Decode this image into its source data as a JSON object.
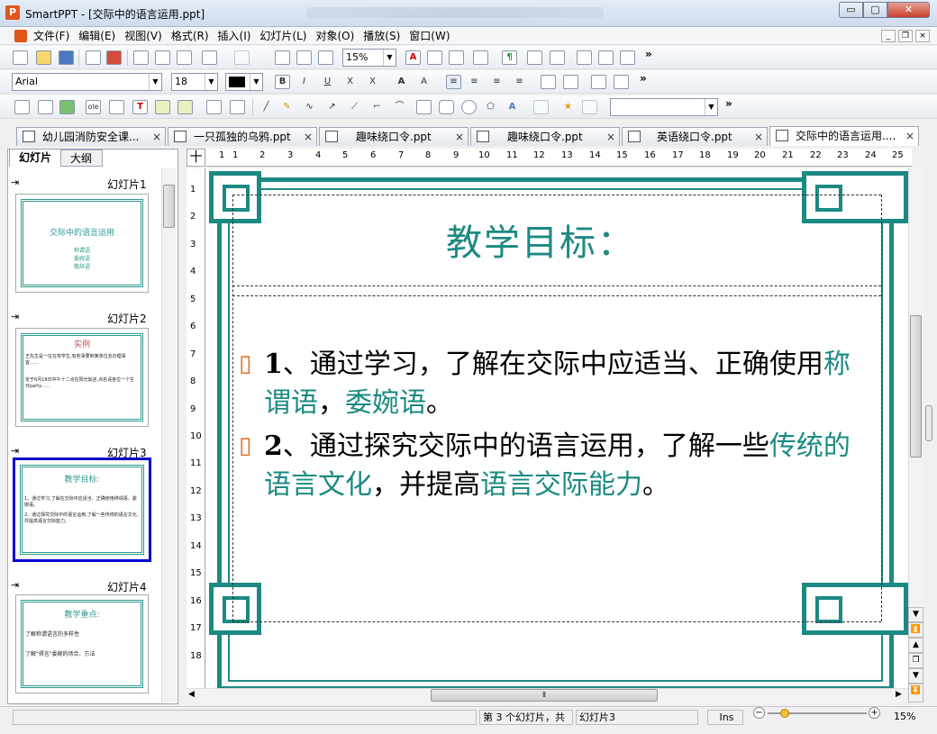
{
  "window": {
    "title": "SmartPPT - [交际中的语言运用.ppt]",
    "app_icon": "P",
    "min_label": "▭",
    "max_label": "▢",
    "close_label": "✕"
  },
  "menu": {
    "items": [
      "文件(F)",
      "编辑(E)",
      "视图(V)",
      "格式(R)",
      "插入(I)",
      "幻灯片(L)",
      "对象(O)",
      "播放(S)",
      "窗口(W)"
    ],
    "mdi_min": "_",
    "mdi_restore": "❐",
    "mdi_close": "×"
  },
  "toolbar1": {
    "zoom_value": "15%",
    "more": "»"
  },
  "toolbar2": {
    "font_name": "Arial",
    "font_size": "18",
    "bold": "B",
    "italic": "I",
    "underline": "U",
    "strike": "X",
    "clear": "X",
    "grow": "A",
    "shrink": "A",
    "more": "»"
  },
  "toolbar3": {
    "more": "»",
    "style_value": ""
  },
  "tabs": [
    {
      "label": "幼儿园消防安全课...",
      "close": "×"
    },
    {
      "label": "一只孤独的乌鸦.ppt",
      "close": "×"
    },
    {
      "label": "趣味绕口令.ppt",
      "close": "×"
    },
    {
      "label": "趣味绕口令.ppt",
      "close": "×"
    },
    {
      "label": "英语绕口令.ppt",
      "close": "×"
    },
    {
      "label": "交际中的语言运用....",
      "close": "×"
    }
  ],
  "panel": {
    "tab_slides": "幻灯片",
    "tab_outline": "大纲",
    "slides": [
      {
        "name": "幻灯片1",
        "title": "交际中的语言运用",
        "lines": [
          "称谓语",
          "委婉语",
          "敬辞语"
        ]
      },
      {
        "name": "幻灯片2",
        "title": "实例",
        "lines": [
          "王先生是一位在校学生,有些事要到某单位去办理事宜……",
          "定于6月18日中午十二点在阳光饭店,点名请各位一个生日party……"
        ]
      },
      {
        "name": "幻灯片3",
        "title": "教学目标:",
        "lines": [
          "1、通过学习,了解在交际中应适当、正确使用称谓语、委婉语。",
          "2、通过探究交际中的语言运用,了解一些传统的语言文化,并提高语言交际能力。"
        ]
      },
      {
        "name": "幻灯片4",
        "title": "教学重点:",
        "lines": [
          "了解称谓语言的多样性",
          "了解\"得言\"委婉的场合、方法"
        ]
      }
    ]
  },
  "ruler": {
    "corner": "十",
    "h": [
      "1",
      "1",
      "2",
      "3",
      "4",
      "5",
      "6",
      "7",
      "8",
      "9",
      "10",
      "11",
      "12",
      "13",
      "14",
      "15",
      "16",
      "17",
      "18",
      "19",
      "20",
      "21",
      "22",
      "23",
      "24",
      "25"
    ],
    "v": [
      "1",
      "2",
      "3",
      "4",
      "5",
      "6",
      "7",
      "8",
      "9",
      "10",
      "11",
      "12",
      "13",
      "14",
      "15",
      "16",
      "17",
      "18"
    ]
  },
  "slide": {
    "title": "教学目标：",
    "bullet_marker": "▯",
    "b1": {
      "n": "1",
      "a": "、通过学习，了解在交际中应适当、正确使用",
      "h1": "称谓语",
      "b": "，",
      "h2": "委婉语",
      "c": "。"
    },
    "b2": {
      "n": "2",
      "a": "、通过探究交际中的语言运用，了解一些",
      "h1": "传统的语言文化",
      "b": "，并提高",
      "h2": "语言交际能力",
      "c": "。"
    }
  },
  "status": {
    "slide_pos": "第 3 个幻灯片，共",
    "slide_name": "幻灯片3",
    "ins": "Ins",
    "zoom": "15%",
    "zoom_fraction": 0.15
  },
  "colors": {
    "accent": "#1b8a82",
    "bullet": "#e06b1b",
    "selection": "#0000cc"
  }
}
